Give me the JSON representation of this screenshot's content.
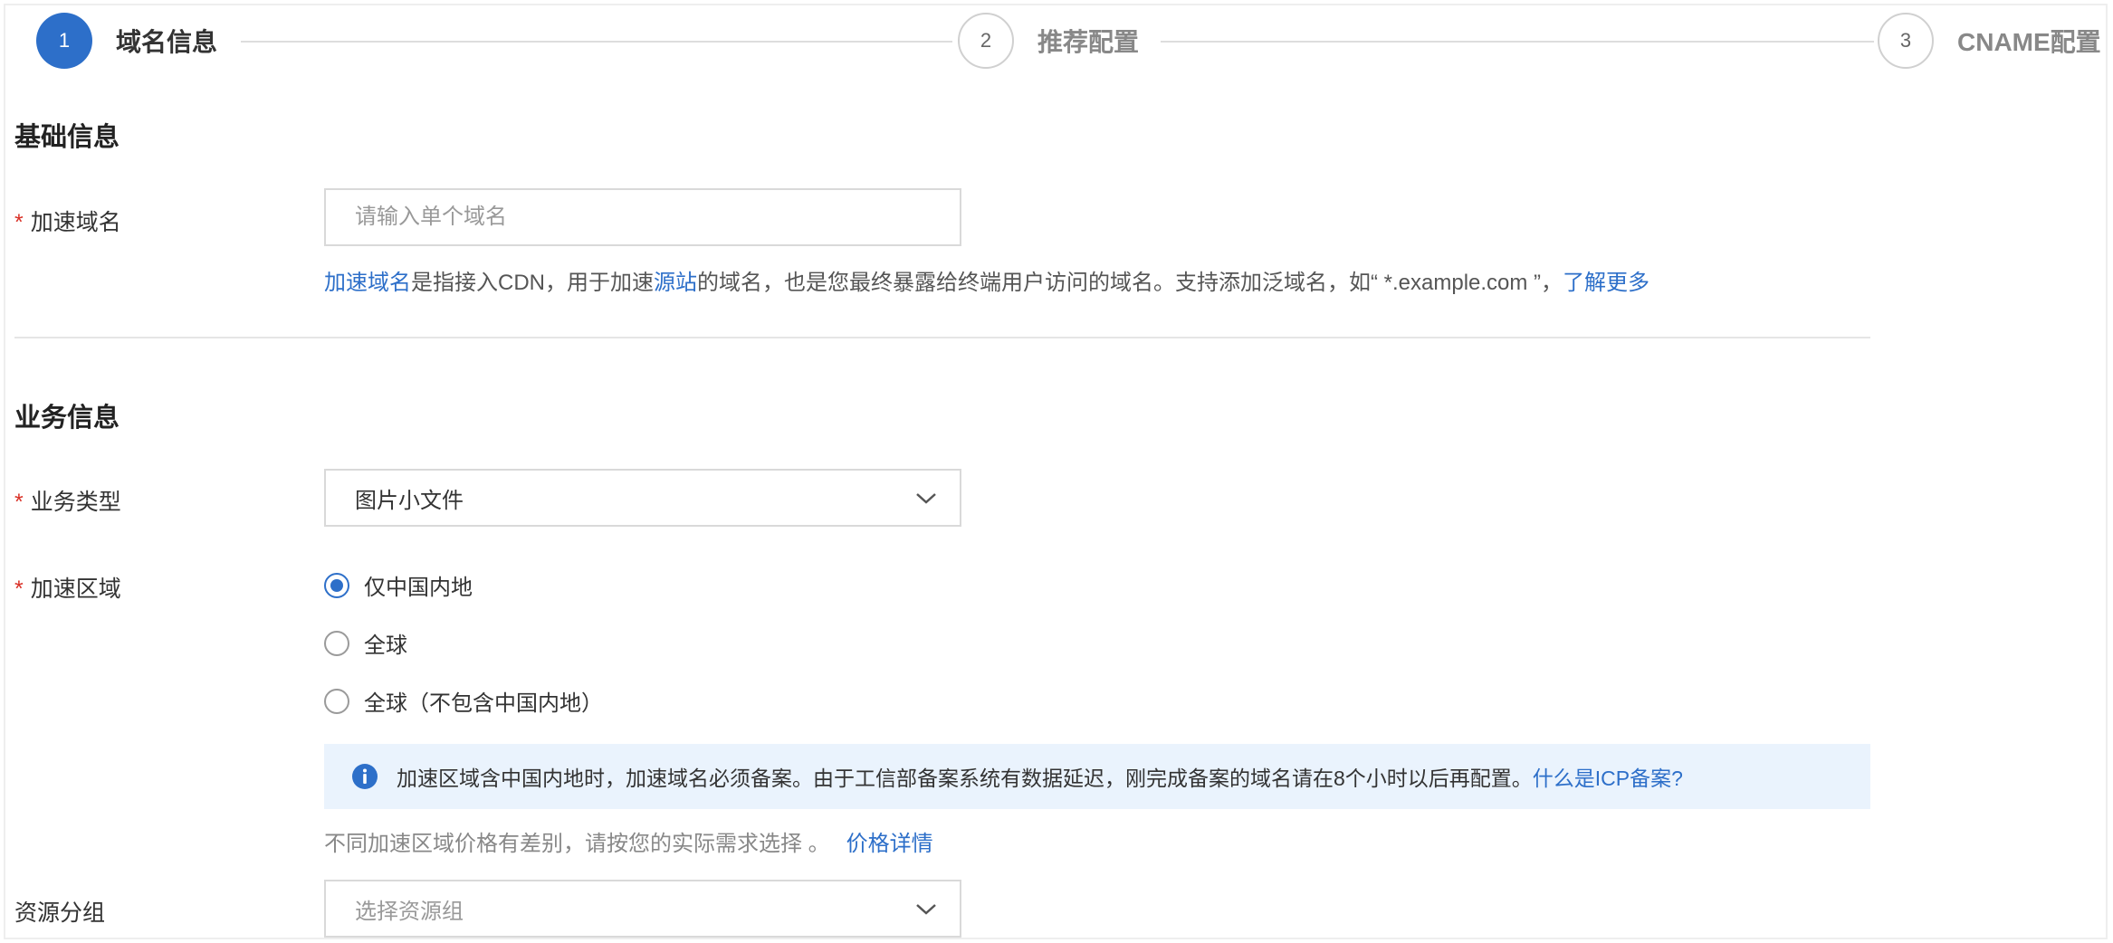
{
  "steps": [
    {
      "number": "1",
      "label": "域名信息",
      "state": "active"
    },
    {
      "number": "2",
      "label": "推荐配置",
      "state": "pending"
    },
    {
      "number": "3",
      "label": "CNAME配置",
      "state": "pending"
    }
  ],
  "basic": {
    "title": "基础信息",
    "domain_label": "加速域名",
    "domain_placeholder": "请输入单个域名",
    "help_link_domain": "加速域名",
    "help_text_1": "是指接入CDN，用于加速",
    "help_link_origin": "源站",
    "help_text_2": "的域名，也是您最终暴露给终端用户访问的域名。支持添加泛域名，如“ *.example.com ”，",
    "help_link_more": "了解更多"
  },
  "business": {
    "title": "业务信息",
    "type_label": "业务类型",
    "type_value": "图片小文件",
    "region_label": "加速区域",
    "region_options": [
      {
        "label": "仅中国内地",
        "checked": true
      },
      {
        "label": "全球",
        "checked": false
      },
      {
        "label": "全球（不包含中国内地）",
        "checked": false
      }
    ],
    "banner_text": "加速区域含中国内地时，加速域名必须备案。由于工信部备案系统有数据延迟，刚完成备案的域名请在8个小时以后再配置。",
    "banner_link": "什么是ICP备案?",
    "price_note": "不同加速区域价格有差别，请按您的实际需求选择 。",
    "price_link": "价格详情",
    "group_label": "资源分组",
    "group_placeholder": "选择资源组"
  },
  "colors": {
    "accent": "#2d6fc9",
    "required": "#d93026",
    "banner_bg": "#eaf3fd"
  }
}
